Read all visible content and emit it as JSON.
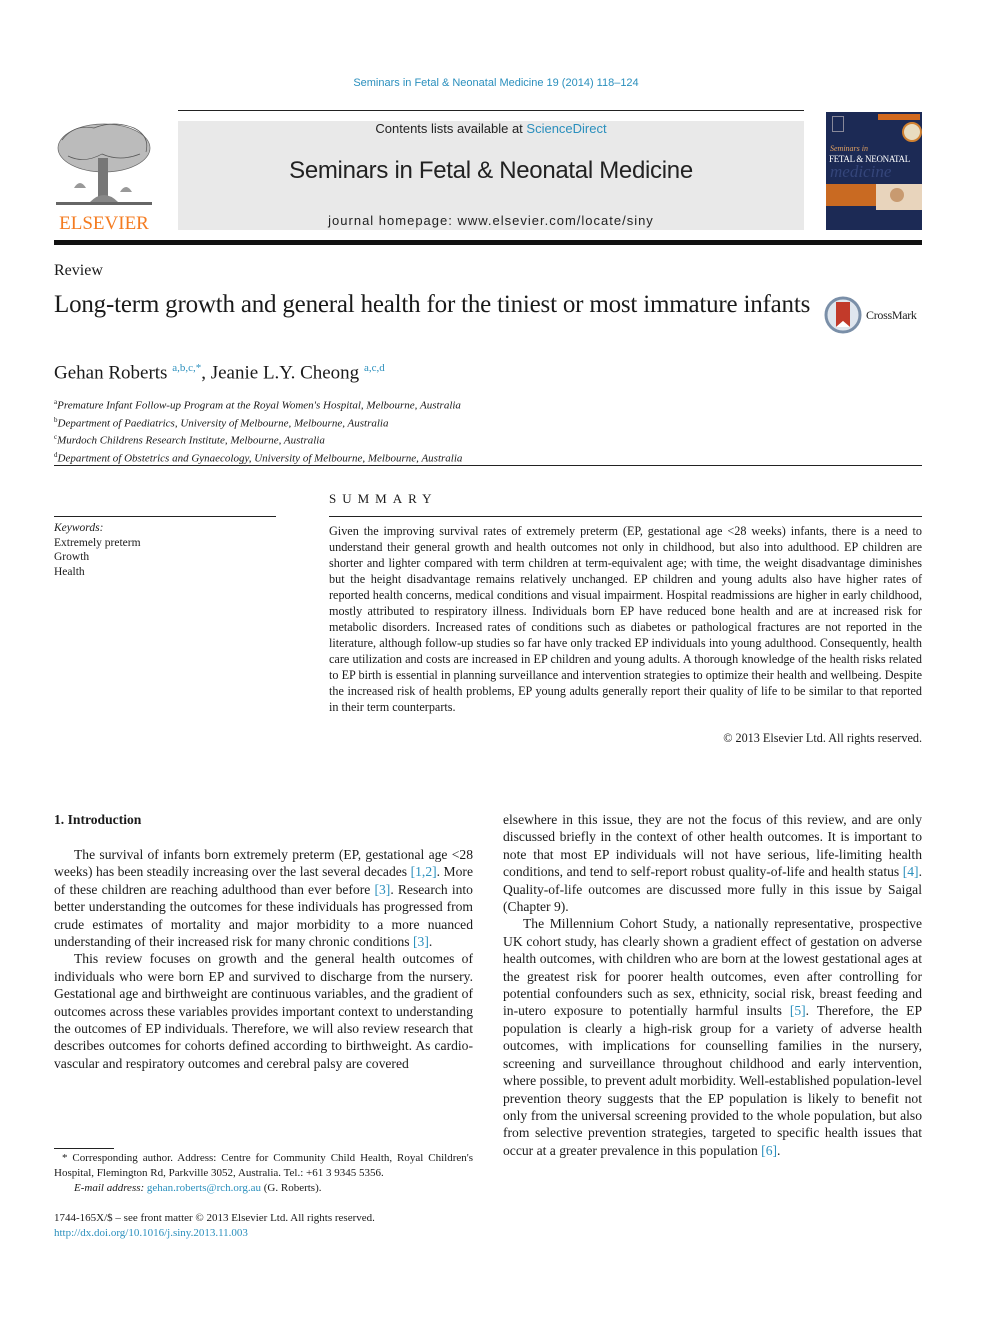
{
  "header": {
    "journal_reference": "Seminars in Fetal & Neonatal Medicine 19 (2014) 118–124",
    "contents_prefix": "Contents lists available at ",
    "contents_link": "ScienceDirect",
    "journal_title": "Seminars in Fetal & Neonatal Medicine",
    "homepage": "journal homepage: www.elsevier.com/locate/siny",
    "publisher_logo_text": "ELSEVIER",
    "cover": {
      "series": "Seminars in",
      "title": "FETAL & NEONATAL",
      "subtitle": "medicine"
    },
    "colors": {
      "link": "#2a8fbd",
      "elsevier_orange": "#f47b20",
      "cover_navy": "#1c2a55",
      "cover_band": "#d2691e"
    }
  },
  "article": {
    "type": "Review",
    "title": "Long-term growth and general health for the tiniest or most immature infants",
    "crossmark_label": "CrossMark",
    "authors": [
      {
        "name": "Gehan Roberts",
        "affils": "a,b,c,",
        "mark": "*"
      },
      {
        "name": "Jeanie L.Y. Cheong",
        "affils": "a,c,d",
        "mark": ""
      }
    ],
    "affiliations": [
      {
        "key": "a",
        "text": "Premature Infant Follow-up Program at the Royal Women's Hospital, Melbourne, Australia"
      },
      {
        "key": "b",
        "text": "Department of Paediatrics, University of Melbourne, Melbourne, Australia"
      },
      {
        "key": "c",
        "text": "Murdoch Childrens Research Institute, Melbourne, Australia"
      },
      {
        "key": "d",
        "text": "Department of Obstetrics and Gynaecology, University of Melbourne, Melbourne, Australia"
      }
    ]
  },
  "keywords": {
    "label": "Keywords:",
    "items": [
      "Extremely preterm",
      "Growth",
      "Health"
    ]
  },
  "summary": {
    "heading": "SUMMARY",
    "text": "Given the improving survival rates of extremely preterm (EP, gestational age <28 weeks) infants, there is a need to understand their general growth and health outcomes not only in childhood, but also into adulthood. EP children are shorter and lighter compared with term children at term-equivalent age; with time, the weight disadvantage diminishes but the height disadvantage remains relatively unchanged. EP children and young adults also have higher rates of reported health concerns, medical conditions and visual impairment. Hospital readmissions are higher in early childhood, mostly attributed to respiratory illness. Individuals born EP have reduced bone health and are at increased risk for metabolic disorders. Increased rates of conditions such as diabetes or pathological fractures are not reported in the literature, although follow-up studies so far have only tracked EP individuals into young adulthood. Consequently, health care utilization and costs are increased in EP children and young adults. A thorough knowledge of the health risks related to EP birth is essential in planning surveillance and intervention strategies to optimize their health and wellbeing. Despite the increased risk of health problems, EP young adults generally report their quality of life to be similar to that reported in their term counterparts.",
    "copyright": "© 2013 Elsevier Ltd. All rights reserved."
  },
  "body": {
    "section_heading": "1.  Introduction",
    "left_paragraphs": [
      [
        {
          "t": "The survival of infants born extremely preterm (EP, gestational age <28 weeks) has been steadily increasing over the last several decades "
        },
        {
          "ref": "[1,2]"
        },
        {
          "t": ". More of these children are reaching adulthood than ever before "
        },
        {
          "ref": "[3]"
        },
        {
          "t": ". Research into better understanding the outcomes for these individuals has progressed from crude estimates of mor­tality and major morbidity to a more nuanced understanding of their increased risk for many chronic conditions "
        },
        {
          "ref": "[3]"
        },
        {
          "t": "."
        }
      ],
      [
        {
          "t": "This review focuses on growth and the general health outcomes of individuals who were born EP and survived to discharge from the nursery. Gestational age and birthweight are continuous variables, and the gradient of outcomes across these variables provides important context to understanding the outcomes of EP in­dividuals. Therefore, we will also review research that describes outcomes for cohorts defined according to birthweight. As cardio­vascular and respiratory outcomes and cerebral palsy are covered"
        }
      ]
    ],
    "right_paragraphs": [
      [
        {
          "t": "elsewhere in this issue, they are not the focus of this review, and are only discussed briefly in the context of other health outcomes. It is important to note that most EP individuals will not have serious, life-limiting health conditions, and tend to self-report robust quality-of-life and health status "
        },
        {
          "ref": "[4]"
        },
        {
          "t": ". Quality-of-life outcomes are discussed more fully in this issue by Saigal (Chapter 9)."
        }
      ],
      [
        {
          "t": "The Millennium Cohort Study, a nationally representative, pro­spective UK cohort study, has clearly shown a gradient effect of gestation on adverse health outcomes, with children who are born at the lowest gestational ages at the greatest risk for poorer health outcomes, even after controlling for potential confounders such as sex, ethnicity, social risk, breast feeding and in-utero exposure to potentially harmful insults "
        },
        {
          "ref": "[5]"
        },
        {
          "t": ". Therefore, the EP population is clearly a high-risk group for a variety of adverse health outcomes, with implications for counselling families in the nursery, screening and surveillance throughout childhood and early intervention, where possible, to prevent adult morbidity. Well-established pop­ulation-level prevention theory suggests that the EP population is likely to benefit not only from the universal screening provided to the whole population, but also from selective prevention strategies, targeted to specific health issues that occur at a greater prevalence in this population "
        },
        {
          "ref": "[6]"
        },
        {
          "t": "."
        }
      ]
    ]
  },
  "footnote": {
    "corresponding": "* Corresponding author. Address: Centre for Community Child Health, Royal Children's Hospital, Flemington Rd, Parkville 3052, Australia. Tel.: +61 3 9345 5356.",
    "email_label": "E-mail address:",
    "email": "gehan.roberts@rch.org.au",
    "email_suffix": " (G. Roberts).",
    "front_matter": "1744-165X/$ – see front matter © 2013 Elsevier Ltd. All rights reserved.",
    "doi": "http://dx.doi.org/10.1016/j.siny.2013.11.003"
  }
}
